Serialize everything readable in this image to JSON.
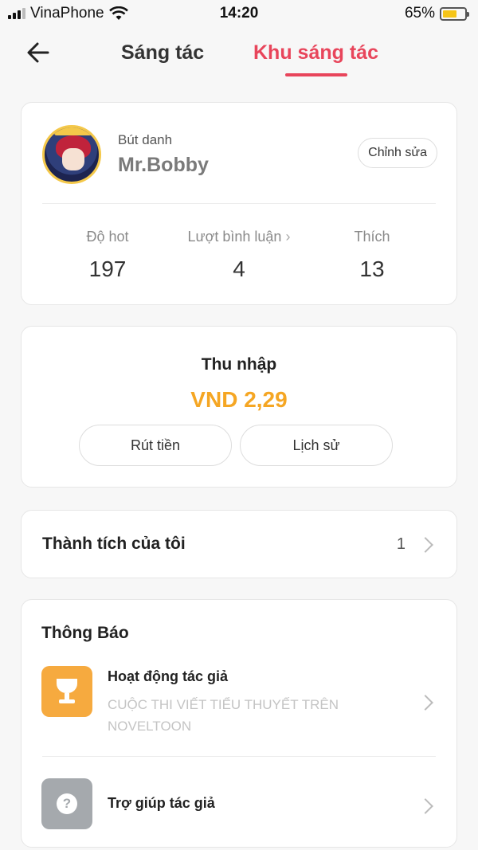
{
  "status_bar": {
    "carrier": "VinaPhone",
    "time": "14:20",
    "battery_percent": "65%",
    "battery_level": 0.65
  },
  "nav": {
    "tab_write": "Sáng tác",
    "tab_zone": "Khu sáng tác",
    "active_tab": "Khu sáng tác"
  },
  "profile": {
    "pen_name_label": "Bút danh",
    "pen_name": "Mr.Bobby",
    "edit_label": "Chỉnh sửa",
    "stats": {
      "hot_label": "Độ hot",
      "hot_value": "197",
      "comments_label": "Lượt bình luận",
      "comments_value": "4",
      "likes_label": "Thích",
      "likes_value": "13"
    }
  },
  "income": {
    "title": "Thu nhập",
    "amount": "VND 2,29",
    "withdraw_label": "Rút tiền",
    "history_label": "Lịch sử"
  },
  "achievements": {
    "label": "Thành tích của tôi",
    "count": "1"
  },
  "notices": {
    "title": "Thông Báo",
    "items": [
      {
        "title": "Hoạt động tác giả",
        "subtitle": "CUỘC THI VIẾT TIỂU THUYẾT TRÊN NOVELTOON",
        "icon": "trophy-icon"
      },
      {
        "title": "Trợ giúp tác giả",
        "icon": "help-icon"
      }
    ]
  },
  "colors": {
    "accent": "#e8455b",
    "income": "#f5a623",
    "activity_icon_bg": "#f6aa3f",
    "help_icon_bg": "#a5a9ad"
  }
}
